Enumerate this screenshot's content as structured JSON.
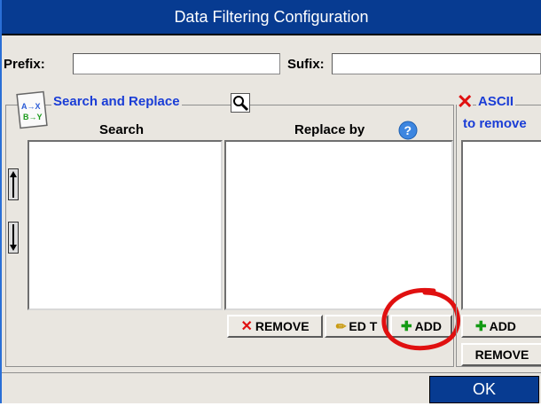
{
  "window": {
    "title": "Data Filtering Configuration"
  },
  "fields": {
    "prefix_label": "Prefix:",
    "prefix_value": "",
    "sufix_label": "Sufix:",
    "sufix_value": ""
  },
  "search_replace": {
    "title": "Search and Replace",
    "icon_text": "A→X B→Y",
    "col_search": "Search",
    "col_replace": "Replace by",
    "remove_label": "REMOVE",
    "edit_label": "ED T",
    "add_label": "ADD"
  },
  "ascii": {
    "title": "ASCII",
    "subtitle": "to remove",
    "add_label": "ADD",
    "remove_label": "REMOVE"
  },
  "footer": {
    "ok_label": "OK"
  },
  "colors": {
    "title_bar": "#073b91",
    "group_title": "#1a3dd6",
    "annotation_circle": "#e01010"
  },
  "icons": [
    "replace-icon",
    "search-magnifier-icon",
    "help-icon",
    "red-x-icon",
    "up-arrow-icon",
    "down-arrow-icon",
    "pencil-icon",
    "plus-icon"
  ]
}
